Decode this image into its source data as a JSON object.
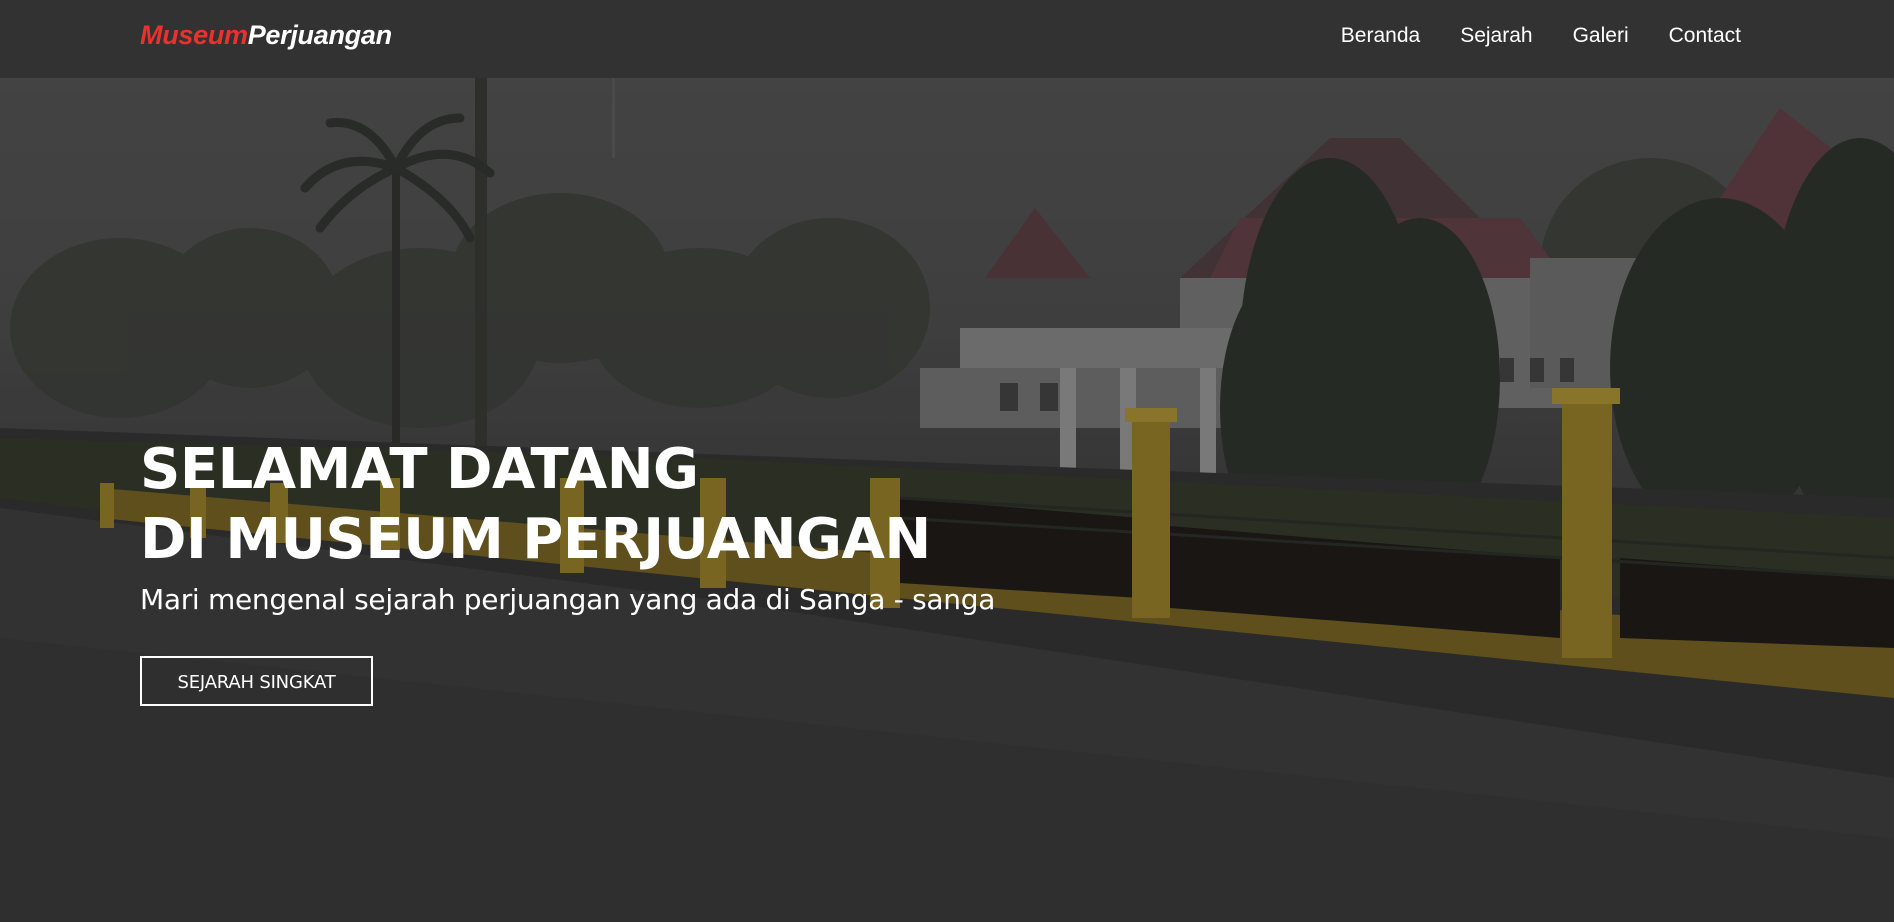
{
  "navbar": {
    "brand": {
      "accent": "Museum",
      "rest": "Perjuangan",
      "accent_color": "#e8322d"
    },
    "menu": [
      {
        "label": "Beranda"
      },
      {
        "label": "Sejarah"
      },
      {
        "label": "Galeri"
      },
      {
        "label": "Contact"
      }
    ]
  },
  "hero": {
    "title_line_1": "SELAMAT DATANG",
    "title_line_2": "DI MUSEUM PERJUANGAN",
    "subtitle": "Mari mengenal sejarah perjuangan yang ada di Sanga - sanga",
    "button_label": "SEJARAH SINGKAT"
  },
  "colors": {
    "navbar_bg": "#323232",
    "accent": "#e8322d",
    "text": "#ffffff"
  }
}
